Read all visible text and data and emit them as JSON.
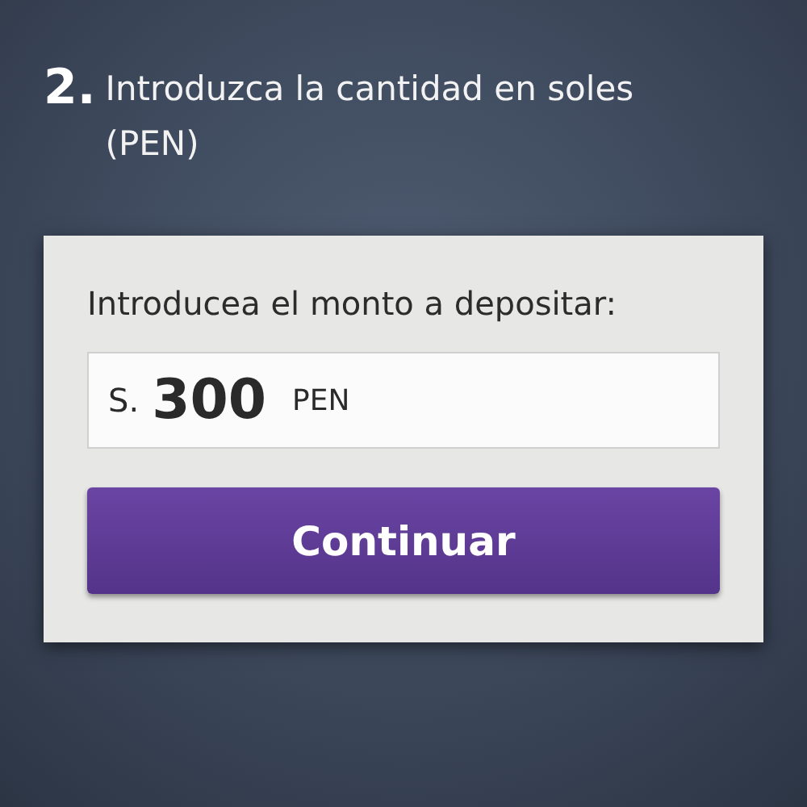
{
  "step": {
    "number": "2.",
    "text": "Introduzca la cantidad en soles (PEN)"
  },
  "form": {
    "label": "Introducea el monto a depositar:",
    "amount": {
      "prefix": "S.",
      "value": "300",
      "currency": "PEN"
    },
    "button": "Continuar"
  }
}
